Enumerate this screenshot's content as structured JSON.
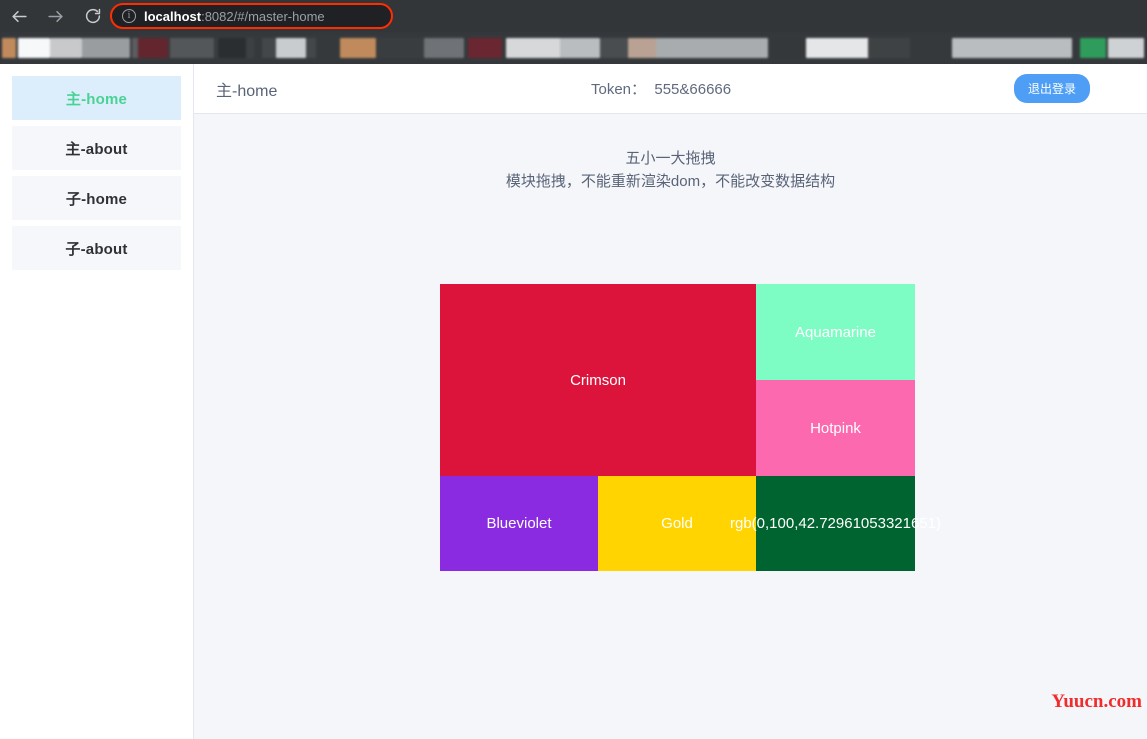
{
  "browser": {
    "back_icon": "arrow-left-icon",
    "forward_icon": "arrow-right-icon",
    "reload_icon": "reload-icon",
    "info_icon": "ⓘ",
    "url_host": "localhost",
    "url_rest": ":8082/#/master-home",
    "url_full": "localhost:8082/#/master-home",
    "omnibox_highlight_color": "#ff2d00",
    "chrome_bg": "#323639"
  },
  "sidebar": {
    "items": [
      {
        "label": "主-home",
        "active": true
      },
      {
        "label": "主-about",
        "active": false
      },
      {
        "label": "子-home",
        "active": false
      },
      {
        "label": "子-about",
        "active": false
      }
    ],
    "active_text_color": "#4ad295",
    "active_bg_color": "#dceefc"
  },
  "header": {
    "title": "主-home",
    "token_label": "Token：",
    "token_value": "555&66666",
    "token_text": "Token：  555&66666",
    "logout_label": "退出登录",
    "logout_color": "#4e9ef5"
  },
  "content": {
    "title": "五小一大拖拽",
    "subtitle": "模块拖拽，不能重新渲染dom，不能改变数据结构",
    "background": "#f4f6fa",
    "blocks": [
      {
        "name": "Crimson",
        "color": "#dc143c"
      },
      {
        "name": "Aquamarine",
        "color": "#7dfcc4"
      },
      {
        "name": "Hotpink",
        "color": "#fc69ae"
      },
      {
        "name": "Blueviolet",
        "color": "#8a2be2"
      },
      {
        "name": "Gold",
        "color": "#ffd400"
      },
      {
        "name": "rgb(0,100,42.72961053321651)",
        "color": "#006430"
      }
    ]
  },
  "watermark": {
    "text": "Yuucn.com",
    "color": "#f12c2c"
  }
}
